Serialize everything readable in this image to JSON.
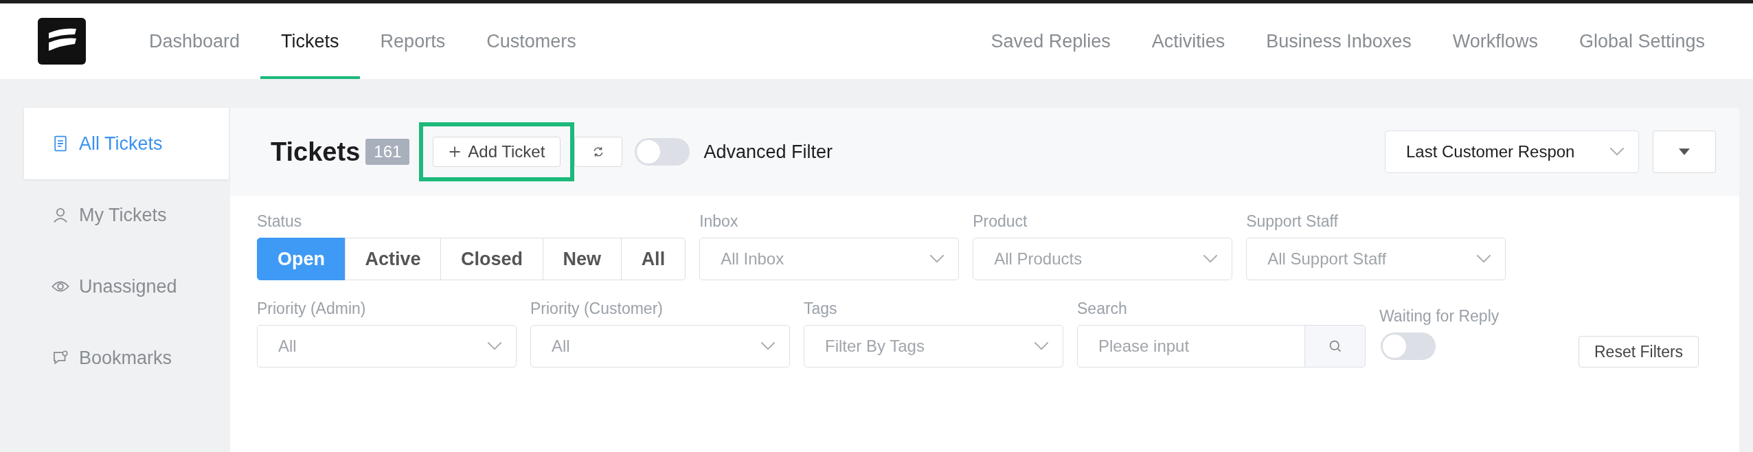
{
  "nav": {
    "left": [
      {
        "label": "Dashboard",
        "selected": false
      },
      {
        "label": "Tickets",
        "selected": true
      },
      {
        "label": "Reports",
        "selected": false
      },
      {
        "label": "Customers",
        "selected": false
      }
    ],
    "right": [
      {
        "label": "Saved Replies"
      },
      {
        "label": "Activities"
      },
      {
        "label": "Business Inboxes"
      },
      {
        "label": "Workflows"
      },
      {
        "label": "Global Settings"
      }
    ]
  },
  "sidebar": {
    "items": [
      {
        "label": "All Tickets",
        "kind": "document",
        "selected": true
      },
      {
        "label": "My Tickets",
        "kind": "person",
        "selected": false
      },
      {
        "label": "Unassigned",
        "kind": "eye",
        "selected": false
      },
      {
        "label": "Bookmarks",
        "kind": "chat",
        "selected": false
      }
    ]
  },
  "header": {
    "title": "Tickets",
    "count": "161",
    "add_button": "Add Ticket",
    "add_highlighted": true,
    "advanced_filter": {
      "label": "Advanced Filter",
      "on": false
    },
    "sort": {
      "value": "Last Customer Respon"
    }
  },
  "filters": {
    "status": {
      "label": "Status",
      "options": [
        {
          "label": "Open",
          "selected": true
        },
        {
          "label": "Active",
          "selected": false
        },
        {
          "label": "Closed",
          "selected": false
        },
        {
          "label": "New",
          "selected": false
        },
        {
          "label": "All",
          "selected": false
        }
      ]
    },
    "row1": [
      {
        "label": "Inbox",
        "placeholder": "All Inbox"
      },
      {
        "label": "Product",
        "placeholder": "All Products"
      },
      {
        "label": "Support Staff",
        "placeholder": "All Support Staff"
      }
    ],
    "row2": [
      {
        "label": "Priority (Admin)",
        "placeholder": "All"
      },
      {
        "label": "Priority (Customer)",
        "placeholder": "All"
      },
      {
        "label": "Tags",
        "placeholder": "Filter By Tags"
      }
    ],
    "search": {
      "label": "Search",
      "placeholder": "Please input"
    },
    "waiting": {
      "label": "Waiting for Reply",
      "on": false
    },
    "reset_button": "Reset Filters"
  }
}
